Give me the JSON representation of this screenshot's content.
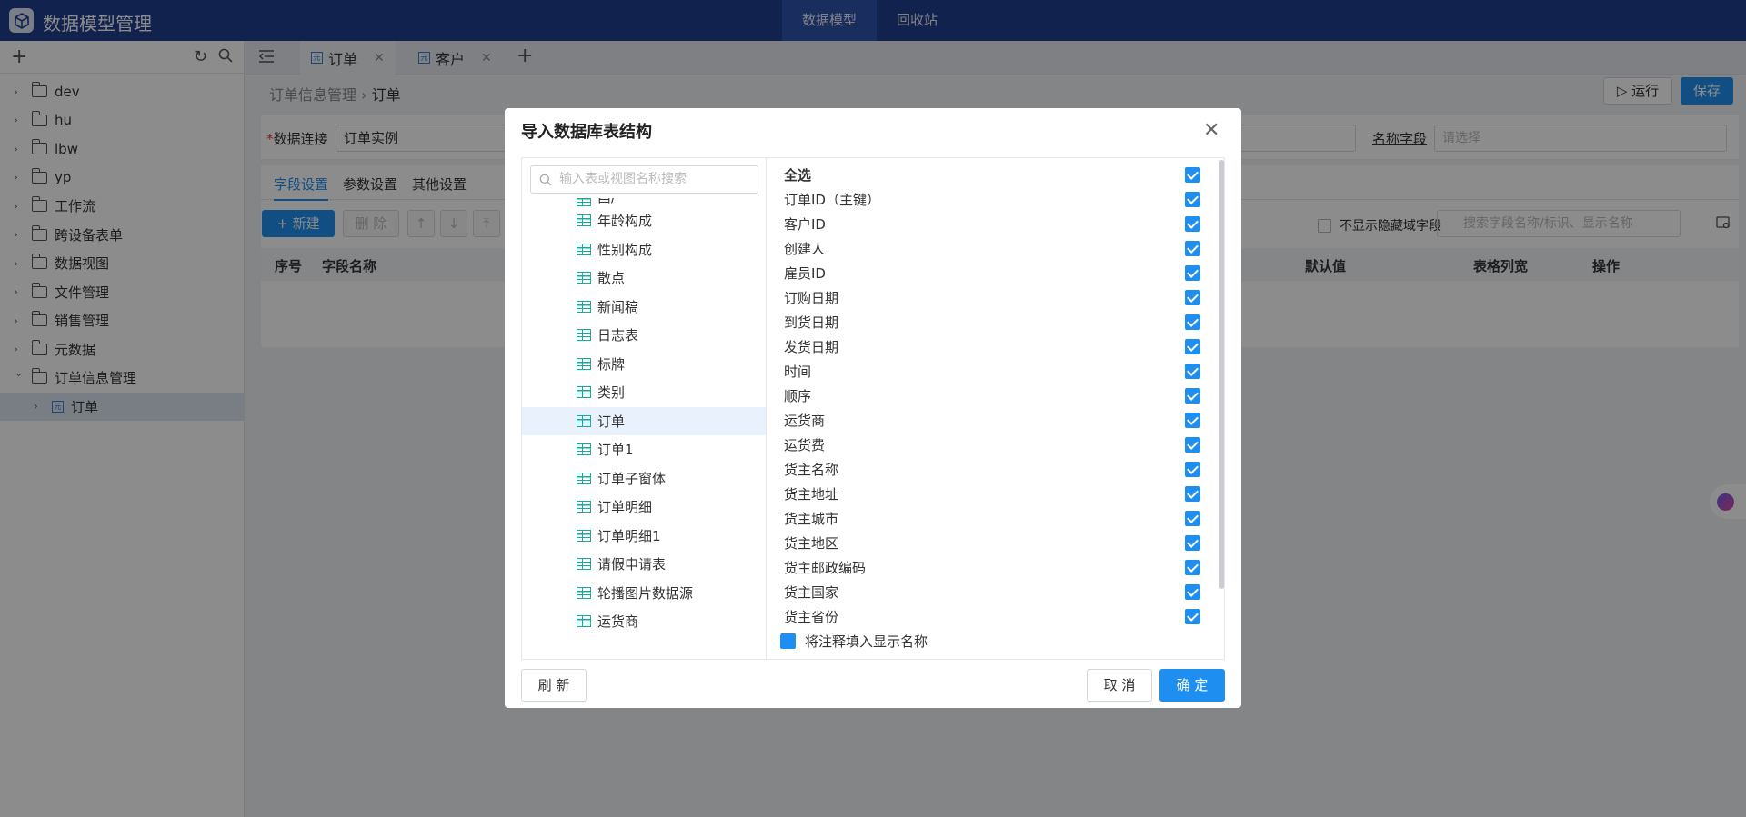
{
  "app": {
    "title": "数据模型管理"
  },
  "topnav": [
    "数据模型",
    "回收站"
  ],
  "sidebar": {
    "items": [
      "dev",
      "hu",
      "lbw",
      "yp",
      "工作流",
      "跨设备表单",
      "数据视图",
      "文件管理",
      "销售管理",
      "元数据",
      "订单信息管理"
    ],
    "child": "订单"
  },
  "tabs": [
    {
      "label": "订单"
    },
    {
      "label": "客户"
    }
  ],
  "breadcrumb": {
    "parent": "订单信息管理",
    "sep": "›",
    "current": "订单"
  },
  "toolbar": {
    "run": "运行",
    "save": "保存"
  },
  "form": {
    "conn_label": "数据连接",
    "conn_value": "订单实例",
    "name_field_label": "名称字段",
    "name_field_placeholder": "请选择"
  },
  "panel_tabs": [
    "字段设置",
    "参数设置",
    "其他设置"
  ],
  "field_toolbar": {
    "new": "新建",
    "delete": "删 除",
    "hide_label": "不显示隐藏域字段",
    "search_placeholder": "搜索字段名称/标识、显示名称"
  },
  "columns": {
    "seq": "序号",
    "name": "字段名称",
    "default": "默认值",
    "width": "表格列宽",
    "ops": "操作"
  },
  "modal": {
    "title": "导入数据库表结构",
    "search_placeholder": "输入表或视图名称搜索",
    "partial_item": "酉/",
    "tables": [
      "年龄构成",
      "性别构成",
      "散点",
      "新闻稿",
      "日志表",
      "标牌",
      "类别",
      "订单",
      "订单1",
      "订单子窗体",
      "订单明细",
      "订单明细1",
      "请假申请表",
      "轮播图片数据源",
      "运货商"
    ],
    "selected_table": "订单",
    "select_all": "全选",
    "fields": [
      "订单ID（主键）",
      "客户ID",
      "创建人",
      "雇员ID",
      "订购日期",
      "到货日期",
      "发货日期",
      "时间",
      "顺序",
      "运货商",
      "运货费",
      "货主名称",
      "货主地址",
      "货主城市",
      "货主地区",
      "货主邮政编码",
      "货主国家",
      "货主省份"
    ],
    "fill_comment": "将注释填入显示名称",
    "refresh": "刷 新",
    "cancel": "取 消",
    "ok": "确 定"
  },
  "colors": {
    "topbar": "#1f3f8f",
    "accent": "#1e8ff0",
    "table_icon": "#18a999"
  }
}
